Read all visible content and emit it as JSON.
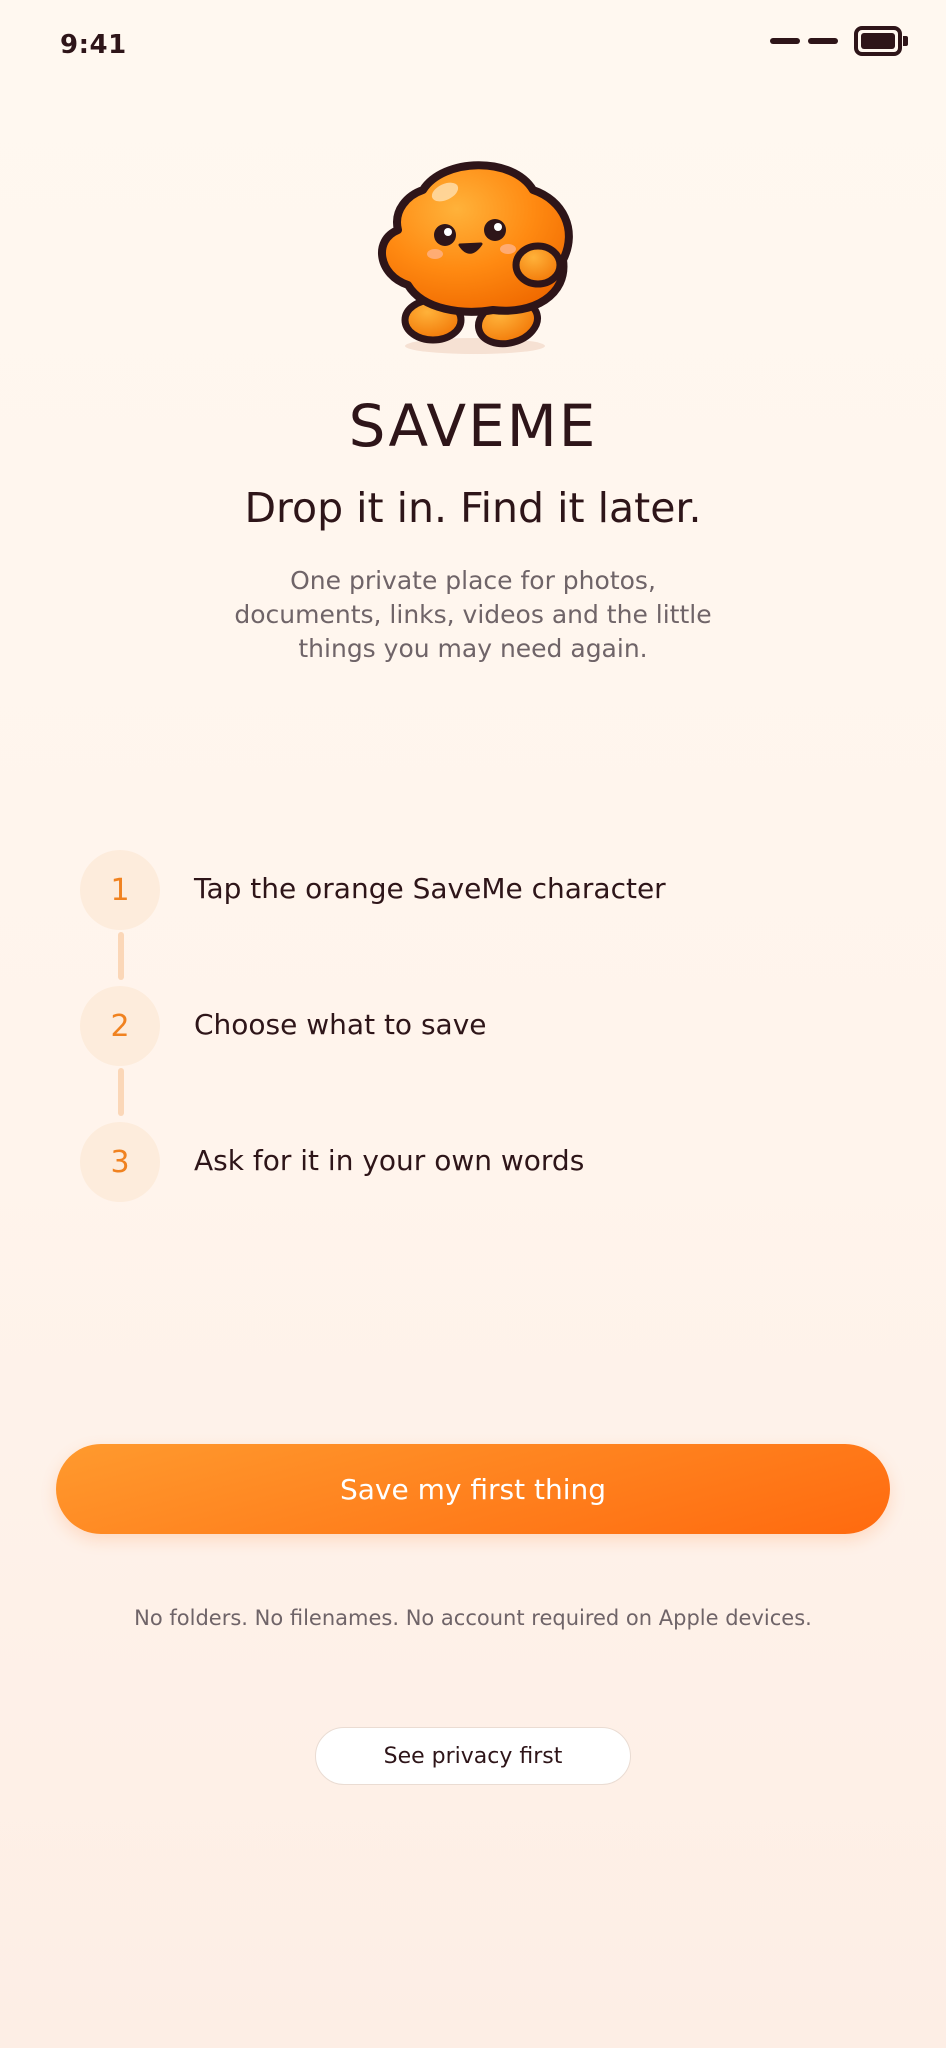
{
  "status_bar": {
    "time": "9:41"
  },
  "hero": {
    "mascot_icon": "saveme-mascot-icon",
    "app_name": "SAVEME",
    "tagline": "Drop it in. Find it later.",
    "description": "One private place for photos, documents, links, videos and the little things you may need again."
  },
  "steps": [
    {
      "number": "1",
      "label": "Tap the orange SaveMe character"
    },
    {
      "number": "2",
      "label": "Choose what to save"
    },
    {
      "number": "3",
      "label": "Ask for it in your own words"
    }
  ],
  "actions": {
    "primary_label": "Save my first thing",
    "footnote": "No folders. No filenames. No account required on Apple devices.",
    "secondary_label": "See privacy first"
  },
  "colors": {
    "accent": "#ff7a1a",
    "text_dark": "#2e1519",
    "text_muted": "#6f6468",
    "background": "#fff6ee"
  }
}
